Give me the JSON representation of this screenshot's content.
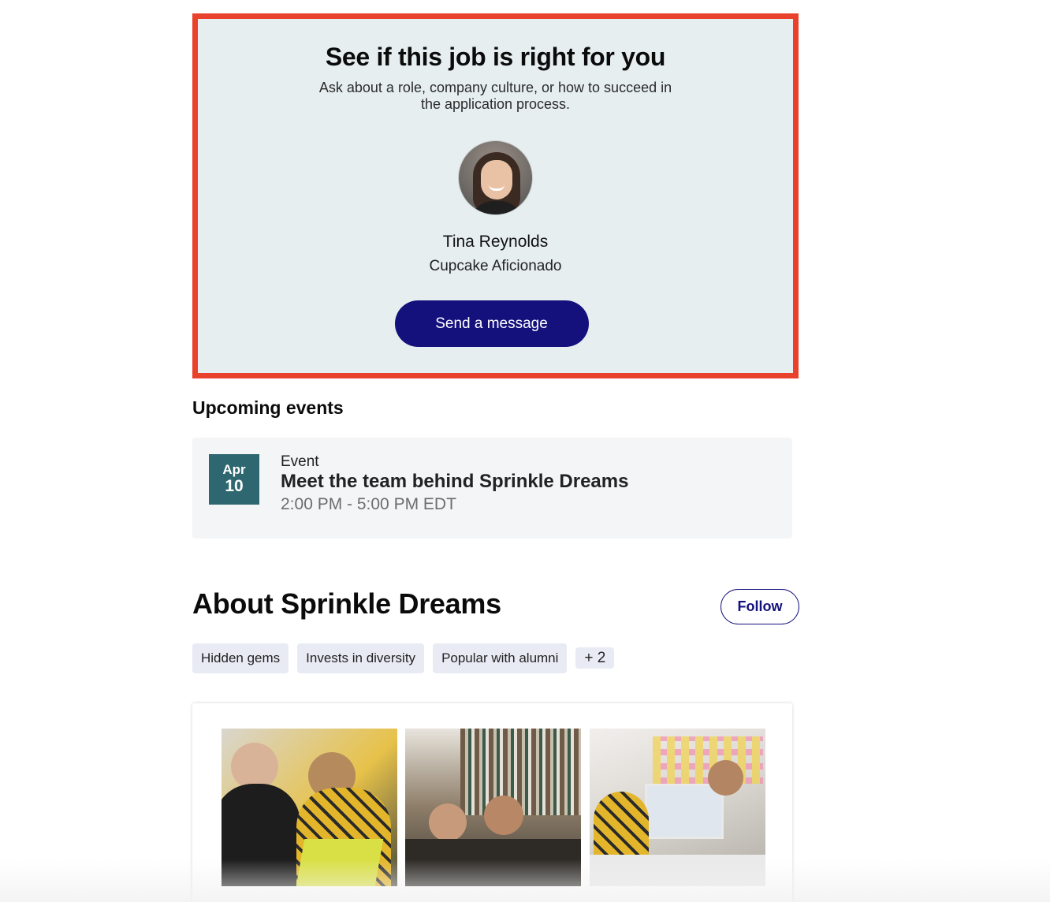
{
  "connect": {
    "title": "See if this job is right for you",
    "subtitle": "Ask about a role, company culture, or how to succeed in the application process.",
    "person_name": "Tina Reynolds",
    "person_role": "Cupcake Aficionado",
    "send_label": "Send a message"
  },
  "events": {
    "heading": "Upcoming events",
    "items": [
      {
        "month": "Apr",
        "day": "10",
        "type": "Event",
        "title": "Meet the team behind Sprinkle Dreams",
        "time": "2:00 PM - 5:00 PM EDT"
      }
    ]
  },
  "about": {
    "heading": "About Sprinkle Dreams",
    "follow_label": "Follow",
    "tags": [
      "Hidden gems",
      "Invests in diversity",
      "Popular with alumni"
    ],
    "more_tags": "+ 2"
  },
  "colors": {
    "highlight_border": "#e8412c",
    "card_background": "#e6eef0",
    "primary_button": "#14107c",
    "event_date_badge": "#2f6770",
    "tag_background": "#e9ebf4"
  },
  "icons": {
    "avatar": "person-photo"
  }
}
